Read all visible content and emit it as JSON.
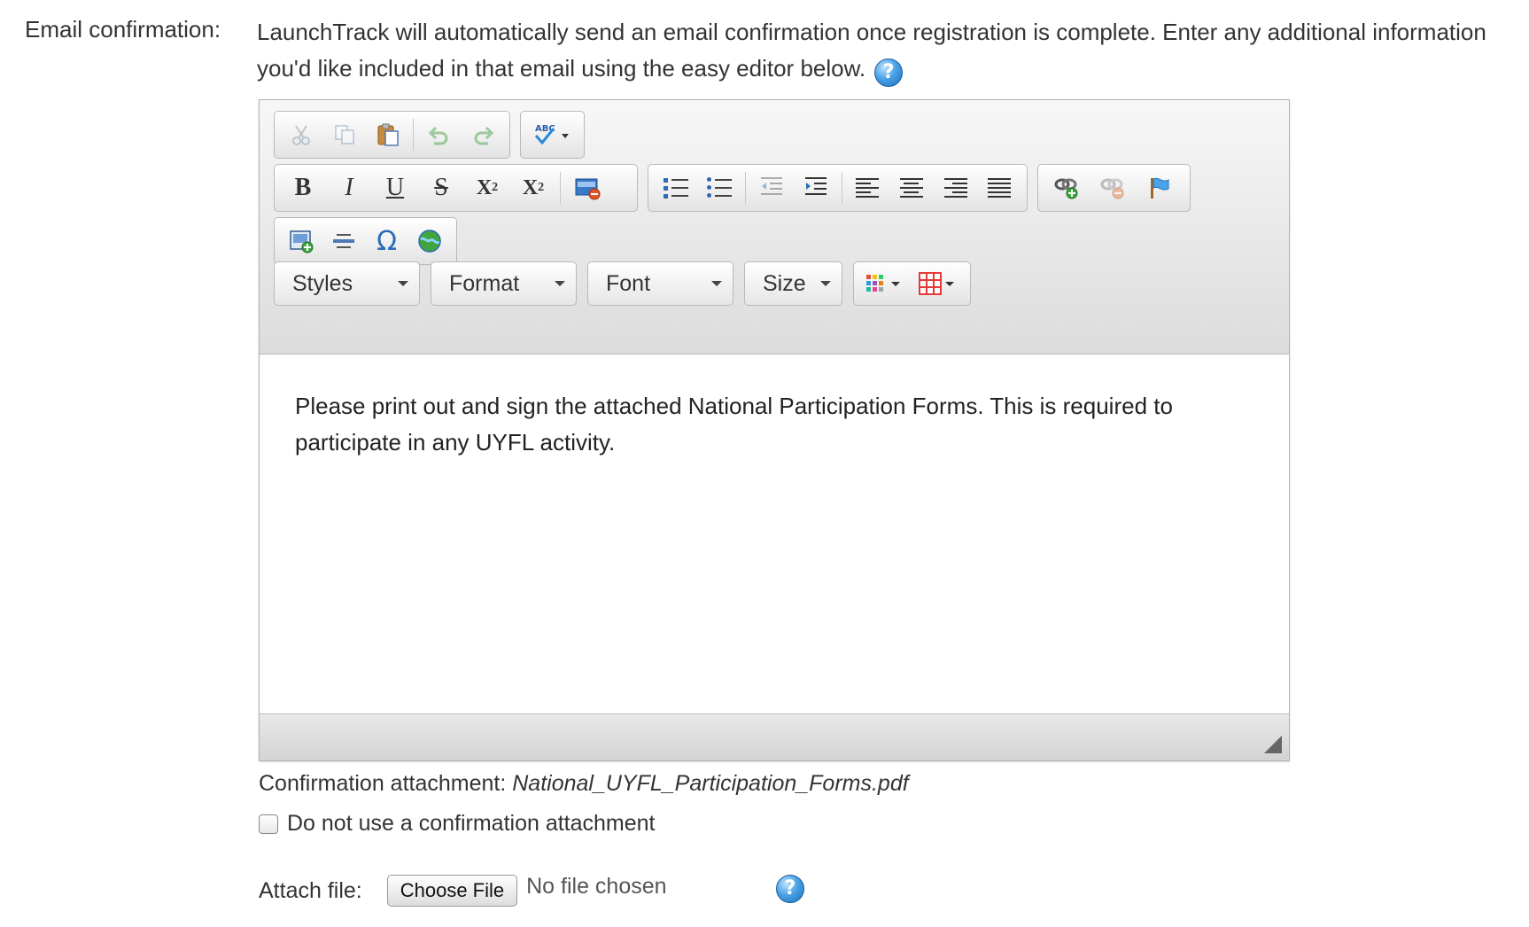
{
  "form": {
    "email_label": "Email confirmation:",
    "description": "LaunchTrack will automatically send an email confirmation once registration is complete. Enter any additional information you'd like included in that email using the easy editor below."
  },
  "toolbar": {
    "clipboard": [
      "cut-icon",
      "copy-icon",
      "paste-icon",
      "undo-icon",
      "redo-icon"
    ],
    "spellcheck_icon": "spellcheck-icon",
    "format_buttons": {
      "bold": "B",
      "italic": "I",
      "underline": "U",
      "strike": "S",
      "subscript": "X",
      "subscript_mark": "2",
      "superscript": "X",
      "superscript_mark": "2"
    },
    "styles_label": "Styles",
    "format_label": "Format",
    "font_label": "Font",
    "size_label": "Size"
  },
  "editor": {
    "content": "Please print out and sign the attached National Participation Forms. This is required to participate in any UYFL activity."
  },
  "attachment": {
    "label": "Confirmation attachment:",
    "filename": "National_UYFL_Participation_Forms.pdf",
    "checkbox_label": "Do not use a confirmation attachment",
    "checked": false
  },
  "file": {
    "label": "Attach file:",
    "button": "Choose File",
    "status": "No file chosen"
  },
  "colors": {
    "help_icon": "#4aa3e6",
    "toolbar_bg": "#dcdcdc",
    "border": "#b3b3b3"
  }
}
